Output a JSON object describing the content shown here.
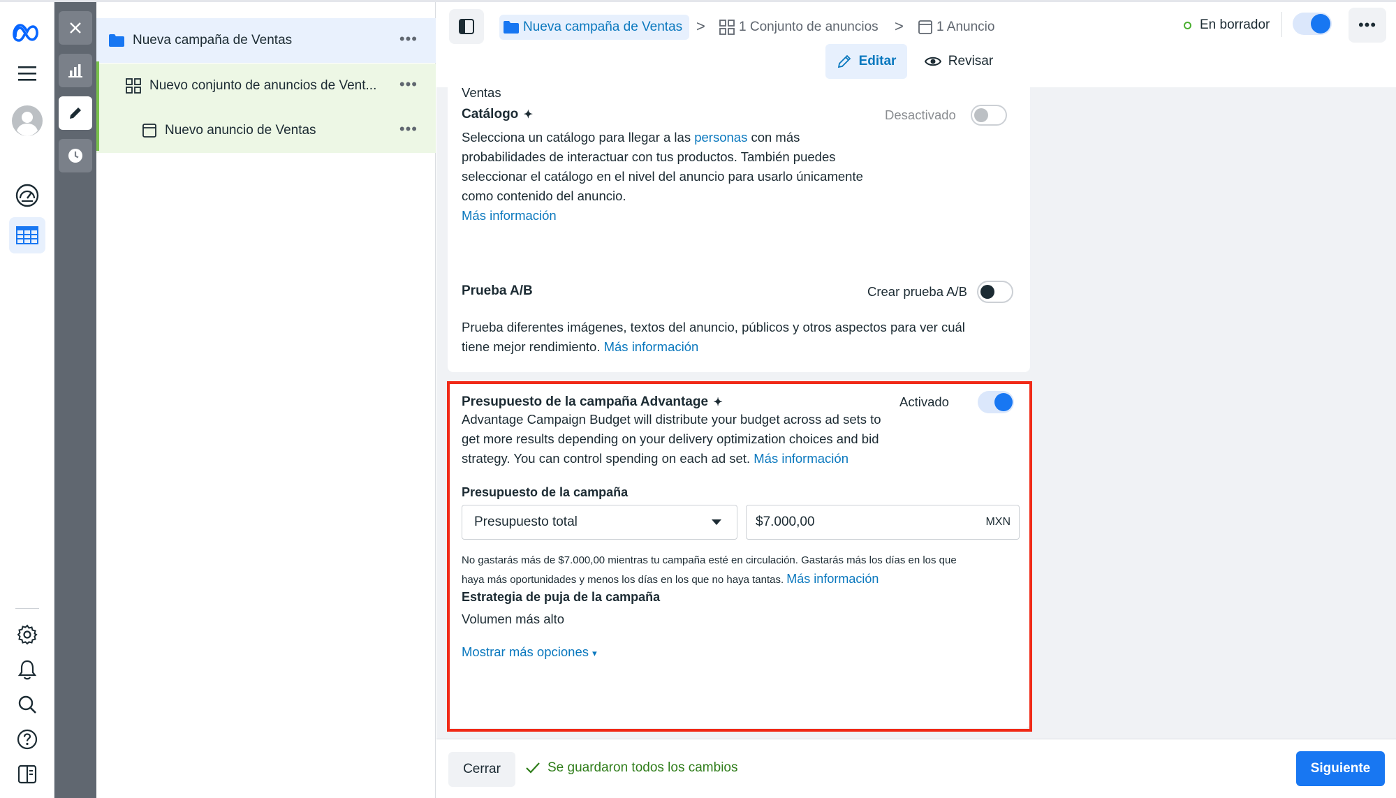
{
  "colors": {
    "accent": "#1877f2",
    "link": "#0a78be",
    "highlight_border": "#f02a17",
    "success": "#2f7d1a"
  },
  "left_nav": {
    "icons": [
      "meta-logo-icon",
      "hamburger-menu-icon",
      "avatar-icon",
      "dashboard-gauge-icon",
      "table-grid-icon",
      "gear-icon",
      "bell-icon",
      "search-icon",
      "help-icon",
      "sidebar-panel-icon"
    ]
  },
  "tool_strip": {
    "icons": [
      "close-icon",
      "bar-chart-icon",
      "pencil-icon",
      "clock-icon"
    ]
  },
  "tree": {
    "campaign": {
      "label": "Nueva campaña de Ventas",
      "more": "•••"
    },
    "adset": {
      "label": "Nuevo conjunto de anuncios de Vent...",
      "more": "•••"
    },
    "ad": {
      "label": "Nuevo anuncio de Ventas",
      "more": "•••"
    }
  },
  "header": {
    "breadcrumb": {
      "campaign": "Nueva campaña de Ventas",
      "adset": "1 Conjunto de anuncios",
      "ad": "1 Anuncio",
      "separator": ">"
    },
    "status": "En borrador",
    "status_toggle_on": true,
    "more": "•••",
    "edit_label": "Editar",
    "review_label": "Revisar"
  },
  "catalog_card": {
    "cut_text": "Ventas",
    "title": "Catálogo",
    "sparkle": "✦",
    "toggle_label": "Desactivado",
    "desc_before": "Selecciona un catálogo para llegar a las ",
    "desc_link": "personas",
    "desc_line1_after": " con más",
    "desc_line2": "probabilidades de interactuar con tus productos. También puedes",
    "desc_line3": "seleccionar el catálogo en el nivel del anuncio para usarlo únicamente",
    "desc_line4": "como contenido del anuncio.",
    "more_info": "Más información"
  },
  "ab_card": {
    "title": "Prueba A/B",
    "toggle_label": "Crear prueba A/B",
    "desc_line1": "Prueba diferentes imágenes, textos del anuncio, públicos y otros aspectos para ver cuál",
    "desc_line2": "tiene mejor rendimiento. ",
    "more_info": "Más información"
  },
  "budget_card": {
    "title": "Presupuesto de la campaña Advantage",
    "sparkle": "✦",
    "toggle_label": "Activado",
    "desc_line1": "Advantage Campaign Budget will distribute your budget across ad sets to",
    "desc_line2": "get more results depending on your delivery optimization choices and bid",
    "desc_line3": "strategy. You can control spending on each ad set. ",
    "more_info": "Más información",
    "budget_label": "Presupuesto de la campaña",
    "budget_type": "Presupuesto total",
    "amount": "$7.000,00",
    "currency": "MXN",
    "note_line1": "No gastarás más de $7.000,00 mientras tu campaña esté en circulación. Gastarás más los días en los que",
    "note_line2": "haya más oportunidades y menos los días en los que no haya tantas. ",
    "note_more_info": "Más información",
    "bid_label": "Estrategia de puja de la campaña",
    "bid_value": "Volumen más alto",
    "show_more": "Mostrar más opciones",
    "show_more_caret": "▾"
  },
  "footer": {
    "close_label": "Cerrar",
    "saved_text": "Se guardaron todos los cambios",
    "next_label": "Siguiente"
  }
}
